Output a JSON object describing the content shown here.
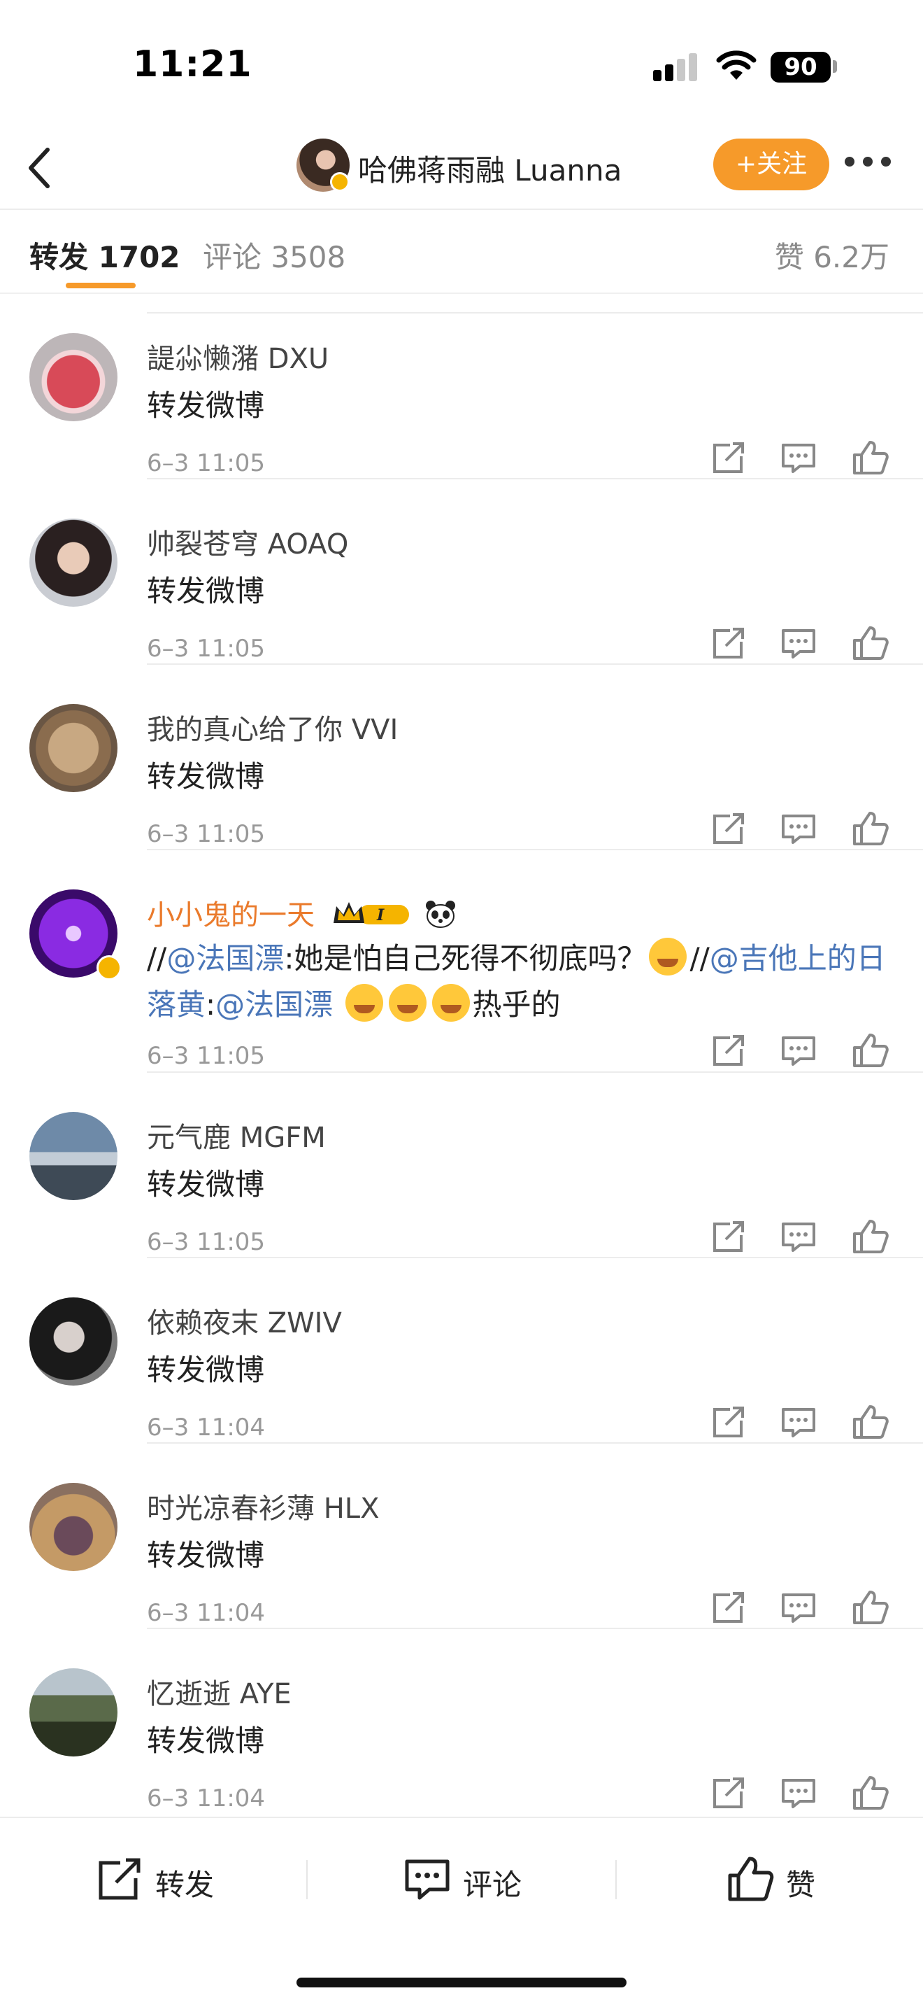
{
  "status_bar": {
    "time": "11:21",
    "battery": "90"
  },
  "header": {
    "account_name": "哈佛蒋雨融 Luanna",
    "follow_label": "+关注"
  },
  "tabs": {
    "reposts": "转发 1702",
    "comments": "评论 3508",
    "likes": "赞 6.2万"
  },
  "reposts": [
    {
      "user": "諟尛懒潴 DXU",
      "text": "转发微博",
      "time": "6–3 11:05"
    },
    {
      "user": "帅裂苍穹 AOAQ",
      "text": "转发微博",
      "time": "6–3 11:05"
    },
    {
      "user": "我的真心给了你 VVI",
      "text": "转发微博",
      "time": "6–3 11:05"
    },
    {
      "user": "小小鬼的一天",
      "text_parts": {
        "p1": "//",
        "m1": "@法国漂",
        "p2": ":她是怕自己死得不彻底吗？",
        "p3": "//",
        "m2": "@吉他上的日落黄",
        "p4": ":",
        "m3": "@法国漂",
        "p5": "热乎的"
      },
      "time": "6–3 11:05"
    },
    {
      "user": "元气鹿 MGFM",
      "text": "转发微博",
      "time": "6–3 11:05"
    },
    {
      "user": "依赖夜末 ZWIV",
      "text": "转发微博",
      "time": "6–3 11:04"
    },
    {
      "user": "时光凉春衫薄 HLX",
      "text": "转发微博",
      "time": "6–3 11:04"
    },
    {
      "user": "忆逝逝 AYE",
      "text": "转发微博",
      "time": "6–3 11:04"
    }
  ],
  "bottom_bar": {
    "repost": "转发",
    "comment": "评论",
    "like": "赞"
  },
  "colors": {
    "accent": "#f69a2a",
    "mention": "#4a76b8",
    "vip_name": "#ea7a2b"
  }
}
